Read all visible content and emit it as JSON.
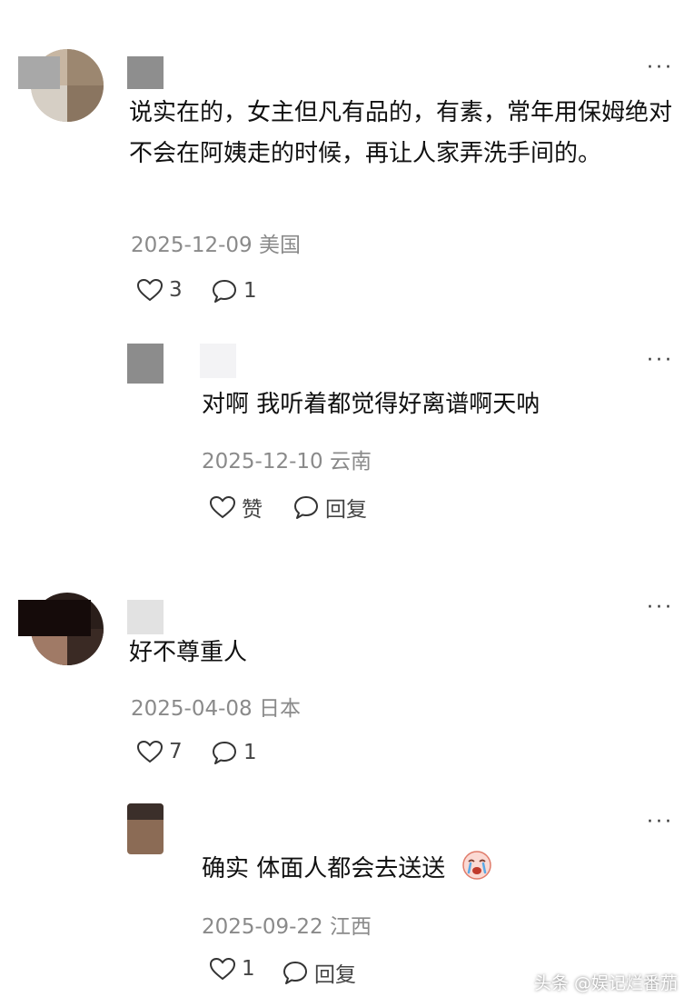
{
  "comments": [
    {
      "text": "说实在的，女主但凡有品的，有素，常年用保姆绝对不会在阿姨走的时候，再让人家弄洗手间的。",
      "date": "2025-12-09",
      "location": "美国",
      "likes": "3",
      "replies": "1"
    },
    {
      "text": "对啊 我听着都觉得好离谱啊天呐",
      "date": "2025-12-10",
      "location": "云南",
      "likes": "赞",
      "replies": "回复"
    },
    {
      "text": "好不尊重人",
      "date": "2025-04-08",
      "location": "日本",
      "likes": "7",
      "replies": "1"
    },
    {
      "text": "确实 体面人都会去送送",
      "date": "2025-09-22",
      "location": "江西",
      "likes": "1",
      "replies": "回复"
    }
  ],
  "more_label": "···",
  "watermark": "头条 @娱记烂番茄",
  "emoji": "crying-face"
}
